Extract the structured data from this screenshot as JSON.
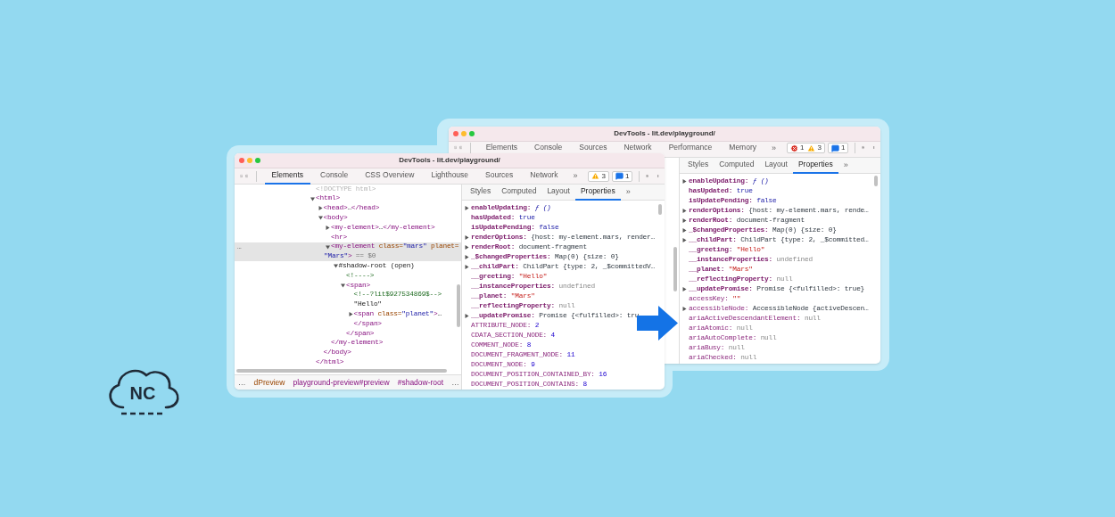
{
  "back_window": {
    "title": "DevTools - lit.dev/playground/",
    "toolbar_tabs": [
      "Elements",
      "Console",
      "Sources",
      "Network",
      "Performance",
      "Memory"
    ],
    "overflow": "»",
    "badge_groups": [
      [
        {
          "kind": "error",
          "count": "1"
        },
        {
          "kind": "warning",
          "count": "3"
        }
      ],
      [
        {
          "kind": "message",
          "count": "1"
        }
      ]
    ],
    "sidebar_tabs": [
      {
        "label": "Styles",
        "selected": false
      },
      {
        "label": "Computed",
        "selected": false
      },
      {
        "label": "Layout",
        "selected": false
      },
      {
        "label": "Properties",
        "selected": true
      }
    ],
    "sidebar_overflow": "»",
    "properties": [
      {
        "expandable": true,
        "own": true,
        "key": "enableUpdating:",
        "value": "ƒ ()",
        "kind": "function"
      },
      {
        "expandable": false,
        "own": true,
        "key": "hasUpdated:",
        "value": "true",
        "kind": "boolean"
      },
      {
        "expandable": false,
        "own": true,
        "key": "isUpdatePending:",
        "value": "false",
        "kind": "boolean"
      },
      {
        "expandable": true,
        "own": true,
        "key": "renderOptions:",
        "value": "{host: my-element.mars, rende…",
        "kind": "object"
      },
      {
        "expandable": true,
        "own": true,
        "key": "renderRoot:",
        "value": "document-fragment",
        "kind": "object"
      },
      {
        "expandable": true,
        "own": true,
        "key": "_$changedProperties:",
        "value": "Map(0) {size: 0}",
        "kind": "object"
      },
      {
        "expandable": true,
        "own": true,
        "key": "__childPart:",
        "value": "ChildPart {type: 2, _$committed…",
        "kind": "object"
      },
      {
        "expandable": false,
        "own": true,
        "key": "__greeting:",
        "value": "\"Hello\"",
        "kind": "string"
      },
      {
        "expandable": false,
        "own": true,
        "key": "__instanceProperties:",
        "value": "undefined",
        "kind": "undefined"
      },
      {
        "expandable": false,
        "own": true,
        "key": "__planet:",
        "value": "\"Mars\"",
        "kind": "string"
      },
      {
        "expandable": false,
        "own": true,
        "key": "__reflectingProperty:",
        "value": "null",
        "kind": "null"
      },
      {
        "expandable": true,
        "own": true,
        "key": "__updatePromise:",
        "value": "Promise {<fulfilled>: true}",
        "kind": "object"
      },
      {
        "expandable": false,
        "own": false,
        "key": "accessKey:",
        "value": "\"\"",
        "kind": "string"
      },
      {
        "expandable": true,
        "own": false,
        "key": "accessibleNode:",
        "value": "AccessibleNode {activeDescen…",
        "kind": "object"
      },
      {
        "expandable": false,
        "own": false,
        "key": "ariaActiveDescendantElement:",
        "value": "null",
        "kind": "null"
      },
      {
        "expandable": false,
        "own": false,
        "key": "ariaAtomic:",
        "value": "null",
        "kind": "null"
      },
      {
        "expandable": false,
        "own": false,
        "key": "ariaAutoComplete:",
        "value": "null",
        "kind": "null"
      },
      {
        "expandable": false,
        "own": false,
        "key": "ariaBusy:",
        "value": "null",
        "kind": "null"
      },
      {
        "expandable": false,
        "own": false,
        "key": "ariaChecked:",
        "value": "null",
        "kind": "null"
      }
    ]
  },
  "front_window": {
    "title": "DevTools - lit.dev/playground/",
    "toolbar_tabs": [
      {
        "label": "Elements",
        "selected": true
      },
      {
        "label": "Console",
        "selected": false
      },
      {
        "label": "CSS Overview",
        "selected": false
      },
      {
        "label": "Lighthouse",
        "selected": false
      },
      {
        "label": "Sources",
        "selected": false
      },
      {
        "label": "Network",
        "selected": false
      }
    ],
    "overflow": "»",
    "badge_groups": [
      [
        {
          "kind": "warning",
          "count": "3"
        }
      ],
      [
        {
          "kind": "message",
          "count": "1"
        }
      ]
    ],
    "dom_tree": [
      {
        "segs": [
          {
            "text": "<!DOCTYPE html>",
            "kind": "faded"
          }
        ],
        "kind": "leaf",
        "selected": false
      },
      {
        "segs": [
          {
            "text": "<html>",
            "kind": "tag"
          }
        ],
        "kind": "expanded",
        "selected": false,
        "children": [
          {
            "segs": [
              {
                "text": "<head>",
                "kind": "tag"
              },
              {
                "text": "…",
                "kind": "text"
              },
              {
                "text": "</head>",
                "kind": "tag"
              }
            ],
            "kind": "collapsed",
            "selected": false
          },
          {
            "segs": [
              {
                "text": "<body>",
                "kind": "tag"
              }
            ],
            "kind": "expanded",
            "selected": false,
            "children": [
              {
                "segs": [
                  {
                    "text": "<my-element>",
                    "kind": "tag"
                  },
                  {
                    "text": "…",
                    "kind": "text"
                  },
                  {
                    "text": "</my-element>",
                    "kind": "tag"
                  }
                ],
                "kind": "collapsed",
                "selected": false
              },
              {
                "segs": [
                  {
                    "text": "<hr>",
                    "kind": "tag"
                  }
                ],
                "kind": "leaf",
                "selected": false
              },
              {
                "gutter": "…",
                "segs": [
                  {
                    "text": "<my-element ",
                    "kind": "tag"
                  },
                  {
                    "text": "class=",
                    "kind": "attr"
                  },
                  {
                    "text": "\"mars\"",
                    "kind": "value"
                  },
                  {
                    "text": " planet=",
                    "kind": "attr"
                  }
                ],
                "cont": [
                  {
                    "text": "\"Mars\"",
                    "kind": "value"
                  },
                  {
                    "text": ">",
                    "kind": "tag"
                  },
                  {
                    "text": " == $0",
                    "kind": "marker"
                  }
                ],
                "kind": "expanded",
                "selected": true,
                "children": [
                  {
                    "segs": [
                      {
                        "text": "#shadow-root (open)",
                        "kind": "text"
                      }
                    ],
                    "kind": "expanded",
                    "selected": false,
                    "children": [
                      {
                        "segs": [
                          {
                            "text": "<!---->",
                            "kind": "comment"
                          }
                        ],
                        "kind": "leaf",
                        "selected": false
                      },
                      {
                        "segs": [
                          {
                            "text": "<span>",
                            "kind": "tag"
                          }
                        ],
                        "kind": "expanded",
                        "selected": false,
                        "children": [
                          {
                            "segs": [
                              {
                                "text": "<!--?lit$927534869$-->",
                                "kind": "comment"
                              }
                            ],
                            "kind": "leaf",
                            "selected": false
                          },
                          {
                            "segs": [
                              {
                                "text": "\"Hello\"",
                                "kind": "text"
                              }
                            ],
                            "kind": "leaf",
                            "selected": false
                          },
                          {
                            "segs": [
                              {
                                "text": "<span ",
                                "kind": "tag"
                              },
                              {
                                "text": "class=",
                                "kind": "attr"
                              },
                              {
                                "text": "\"planet\"",
                                "kind": "value"
                              },
                              {
                                "text": ">",
                                "kind": "tag"
                              },
                              {
                                "text": "…",
                                "kind": "text"
                              }
                            ],
                            "kind": "collapsed",
                            "selected": false
                          },
                          {
                            "segs": [
                              {
                                "text": "</span>",
                                "kind": "tag"
                              }
                            ],
                            "kind": "leaf",
                            "selected": false
                          }
                        ]
                      },
                      {
                        "segs": [
                          {
                            "text": "</span>",
                            "kind": "tag"
                          }
                        ],
                        "kind": "leaf",
                        "selected": false
                      }
                    ]
                  }
                ]
              },
              {
                "segs": [
                  {
                    "text": "</my-element>",
                    "kind": "tag"
                  }
                ],
                "kind": "leaf",
                "selected": false
              }
            ]
          },
          {
            "segs": [
              {
                "text": "</body>",
                "kind": "tag"
              }
            ],
            "kind": "leaf",
            "selected": false
          }
        ]
      },
      {
        "segs": [
          {
            "text": "</html>",
            "kind": "tag"
          }
        ],
        "kind": "leaf",
        "selected": false
      }
    ],
    "breadcrumbs": [
      {
        "label": "…",
        "kind": "ellipsis"
      },
      {
        "label": "dPreview",
        "kind": "partial"
      },
      {
        "label": "playground-preview#preview",
        "kind": "element"
      },
      {
        "label": "#shadow-root",
        "kind": "element"
      },
      {
        "label": "…",
        "kind": "ellipsis"
      }
    ],
    "sidebar_tabs": [
      {
        "label": "Styles",
        "selected": false
      },
      {
        "label": "Computed",
        "selected": false
      },
      {
        "label": "Layout",
        "selected": false
      },
      {
        "label": "Properties",
        "selected": true
      }
    ],
    "sidebar_overflow": "»",
    "properties": [
      {
        "expandable": true,
        "own": true,
        "key": "enableUpdating:",
        "value": "ƒ ()",
        "kind": "function"
      },
      {
        "expandable": false,
        "own": true,
        "key": "hasUpdated:",
        "value": "true",
        "kind": "boolean"
      },
      {
        "expandable": false,
        "own": true,
        "key": "isUpdatePending:",
        "value": "false",
        "kind": "boolean"
      },
      {
        "expandable": true,
        "own": true,
        "key": "renderOptions:",
        "value": "{host: my-element.mars, render…",
        "kind": "object"
      },
      {
        "expandable": true,
        "own": true,
        "key": "renderRoot:",
        "value": "document-fragment",
        "kind": "object"
      },
      {
        "expandable": true,
        "own": true,
        "key": "_$changedProperties:",
        "value": "Map(0) {size: 0}",
        "kind": "object"
      },
      {
        "expandable": true,
        "own": true,
        "key": "__childPart:",
        "value": "ChildPart {type: 2, _$committedV…",
        "kind": "object"
      },
      {
        "expandable": false,
        "own": true,
        "key": "__greeting:",
        "value": "\"Hello\"",
        "kind": "string"
      },
      {
        "expandable": false,
        "own": true,
        "key": "__instanceProperties:",
        "value": "undefined",
        "kind": "undefined"
      },
      {
        "expandable": false,
        "own": true,
        "key": "__planet:",
        "value": "\"Mars\"",
        "kind": "string"
      },
      {
        "expandable": false,
        "own": true,
        "key": "__reflectingProperty:",
        "value": "null",
        "kind": "null"
      },
      {
        "expandable": true,
        "own": true,
        "key": "__updatePromise:",
        "value": "Promise {<fulfilled>: tru",
        "kind": "object"
      },
      {
        "expandable": false,
        "own": false,
        "key": "ATTRIBUTE_NODE:",
        "value": "2",
        "kind": "number"
      },
      {
        "expandable": false,
        "own": false,
        "key": "CDATA_SECTION_NODE:",
        "value": "4",
        "kind": "number"
      },
      {
        "expandable": false,
        "own": false,
        "key": "COMMENT_NODE:",
        "value": "8",
        "kind": "number"
      },
      {
        "expandable": false,
        "own": false,
        "key": "DOCUMENT_FRAGMENT_NODE:",
        "value": "11",
        "kind": "number"
      },
      {
        "expandable": false,
        "own": false,
        "key": "DOCUMENT_NODE:",
        "value": "9",
        "kind": "number"
      },
      {
        "expandable": false,
        "own": false,
        "key": "DOCUMENT_POSITION_CONTAINED_BY:",
        "value": "16",
        "kind": "number"
      },
      {
        "expandable": false,
        "own": false,
        "key": "DOCUMENT_POSITION_CONTAINS:",
        "value": "8",
        "kind": "number"
      }
    ]
  },
  "logo": {
    "text": "NC"
  }
}
